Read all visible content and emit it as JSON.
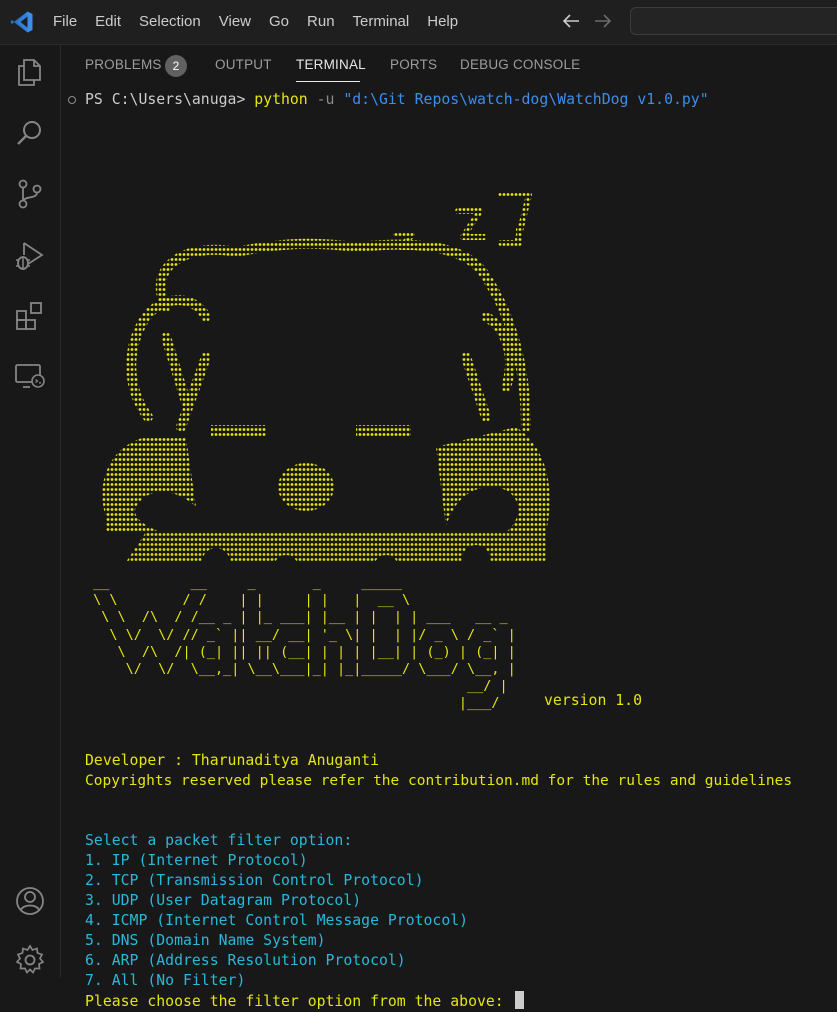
{
  "menu": [
    "File",
    "Edit",
    "Selection",
    "View",
    "Go",
    "Run",
    "Terminal",
    "Help"
  ],
  "panel_tabs": {
    "problems": "PROBLEMS",
    "problems_count": "2",
    "output": "OUTPUT",
    "terminal": "TERMINAL",
    "ports": "PORTS",
    "debug_console": "DEBUG CONSOLE"
  },
  "activity_icons": [
    "explorer-icon",
    "search-icon",
    "source-control-icon",
    "run-debug-icon",
    "extensions-icon",
    "remote-explorer-icon",
    "account-icon",
    "settings-gear-icon"
  ],
  "terminal": {
    "prompt": "PS C:\\Users\\anuga> ",
    "command": "python",
    "flag": " -u ",
    "script_path": "\"d:\\Git Repos\\watch-dog\\WatchDog v1.0.py\"",
    "banner_ascii": " __          __     _       _     _____\n \\ \\        / /    | |     | |   |  __ \\\n  \\ \\  /\\  / /__ _ | |_ ___| |__ | |  | | ___   __ _\n   \\ \\/  \\/ // _` || __/ __| '_ \\| |  | |/ _ \\ / _` |\n    \\  /\\  /| (_| || || (__| | | | |__| | (_) | (_| |\n     \\/  \\/  \\__,_| \\__\\___|_| |_|_____/ \\___/ \\__, |\n                                               __/ |\n                                              |___/",
    "version": "version 1.0",
    "developer": "Developer : Tharunaditya Anuganti",
    "copyright": "Copyrights reserved please refer the contribution.md for the rules and guidelines",
    "menu_title": "Select a packet filter option:",
    "options": [
      "1. IP (Internet Protocol)",
      "2. TCP (Transmission Control Protocol)",
      "3. UDP (User Datagram Protocol)",
      "4. ICMP (Internet Control Message Protocol)",
      "5. DNS (Domain Name System)",
      "6. ARP (Address Resolution Protocol)",
      "7. All (No Filter)"
    ],
    "input_prompt": "Please choose the filter option from the above: "
  },
  "colors": {
    "accent_yellow": "#e5e510",
    "accent_cyan": "#29b8db",
    "vscode_blue": "#3b8eea",
    "background": "#181818"
  }
}
